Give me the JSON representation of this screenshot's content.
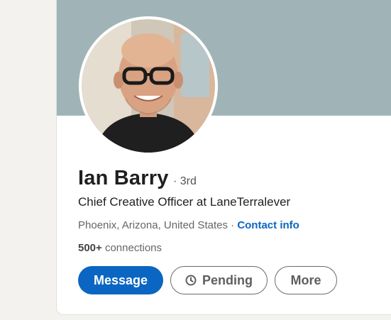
{
  "profile": {
    "name": "Ian Barry",
    "degree": "· 3rd",
    "headline": "Chief Creative Officer at LaneTerralever",
    "location": "Phoenix, Arizona, United States",
    "location_separator": " · ",
    "contact_info": "Contact info",
    "connections_count": "500+",
    "connections_label": " connections"
  },
  "actions": {
    "message": "Message",
    "pending": "Pending",
    "more": "More"
  },
  "colors": {
    "accent": "#0a66c2",
    "cover": "#a0b4b7",
    "page_background": "#f3f2ef"
  },
  "icons": {
    "pending": "clock-icon"
  }
}
